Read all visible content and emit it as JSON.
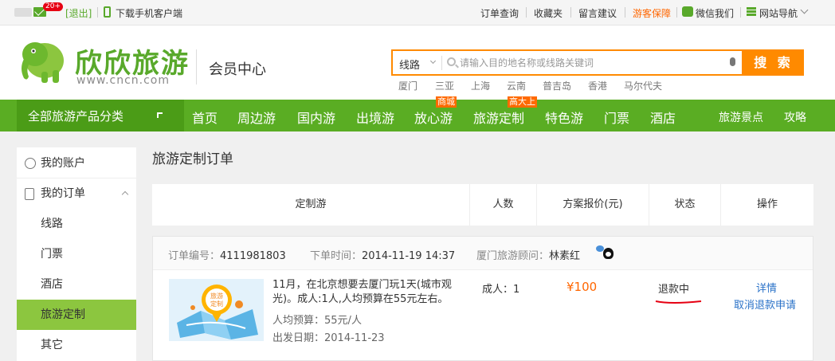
{
  "topbar": {
    "mail_count": "20+",
    "logout": "[退出]",
    "app_download": "下载手机客户端",
    "links": [
      "订单查询",
      "收藏夹",
      "留言建议",
      "游客保障",
      "微信我们",
      "网站导航"
    ]
  },
  "header": {
    "logo_text": "欣欣旅游",
    "logo_url": "www.cncn.com",
    "member_center": "会员中心",
    "search": {
      "select_value": "线路",
      "placeholder": "请输入目的地名称或线路关键词",
      "button": "搜 索"
    },
    "hot_destinations": [
      "厦门",
      "三亚",
      "上海",
      "云南",
      "普吉岛",
      "香港",
      "马尔代夫"
    ]
  },
  "nav": {
    "all_categories": "全部旅游产品分类",
    "items": [
      "首页",
      "周边游",
      "国内游",
      "出境游",
      "放心游",
      "旅游定制",
      "特色游",
      "门票",
      "酒店"
    ],
    "tags": {
      "mall": "商城",
      "custom": "高大上"
    },
    "right_items": [
      "旅游景点",
      "攻略"
    ]
  },
  "sidebar": {
    "account": "我的账户",
    "orders": "我的订单",
    "sub_items": [
      "线路",
      "门票",
      "酒店",
      "旅游定制",
      "其它"
    ]
  },
  "main": {
    "title": "旅游定制订单",
    "columns": [
      "定制游",
      "人数",
      "方案报价(元)",
      "状态",
      "操作"
    ],
    "order": {
      "number_label": "订单编号：",
      "number": "4111981803",
      "time_label": "下单时间：",
      "time": "2014-11-19 14:37",
      "consultant_label": "厦门旅游顾问：",
      "consultant": "林素红",
      "thumb_text": "旅游定制",
      "description": "11月，在北京想要去厦门玩1天(城市观光)。成人:1人,人均预算在55元左右。",
      "budget_label": "人均预算：",
      "budget": "55元/人",
      "depart_label": "出发日期：",
      "depart": "2014-11-23",
      "people": "成人：1",
      "price": "¥100",
      "status": "退款中",
      "action_detail": "详情",
      "action_cancel": "取消退款申请"
    }
  },
  "colors": {
    "brand_green": "#5aad23",
    "search_orange": "#ff8a00",
    "price_orange": "#ff6600",
    "link_blue": "#2a72c8",
    "active_green": "#8cc63f"
  }
}
